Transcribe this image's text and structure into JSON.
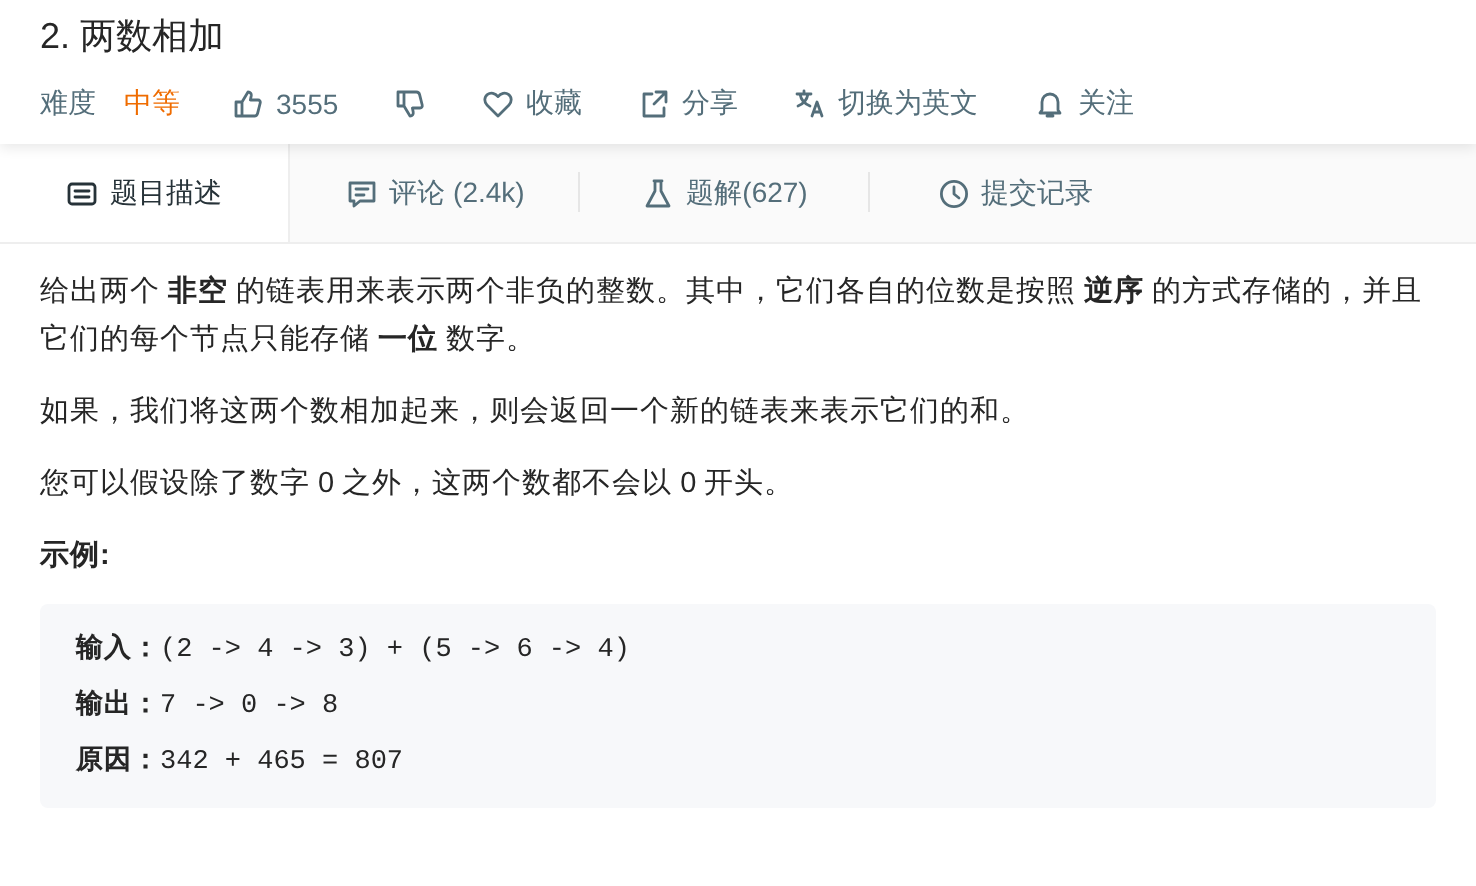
{
  "problem": {
    "title": "2. 两数相加"
  },
  "meta": {
    "difficulty_label": "难度",
    "difficulty": "中等",
    "actions": [
      {
        "kind": "like",
        "label": "3555"
      },
      {
        "kind": "dislike"
      },
      {
        "kind": "favorite",
        "label": "收藏"
      },
      {
        "kind": "share",
        "label": "分享"
      },
      {
        "kind": "translate",
        "label": "切换为英文"
      },
      {
        "kind": "follow",
        "label": "关注"
      }
    ]
  },
  "tabs": [
    {
      "kind": "description",
      "label": "题目描述",
      "selected": true
    },
    {
      "kind": "comments",
      "label": "评论 (2.4k)",
      "selected": false
    },
    {
      "kind": "solutions",
      "label": "题解(627)",
      "selected": false
    },
    {
      "kind": "submissions",
      "label": "提交记录",
      "selected": false
    }
  ],
  "description": {
    "paragraphs": [
      "给出两个 **非空** 的链表用来表示两个非负的整数。其中，它们各自的位数是按照 **逆序** 的方式存储的，并且它们的每个节点只能存储 **一位** 数字。",
      "如果，我们将这两个数相加起来，则会返回一个新的链表来表示它们的和。",
      "您可以假设除了数字 0 之外，这两个数都不会以 0 开头。"
    ],
    "example_heading": "示例:",
    "example_lines": [
      {
        "label": "输入：",
        "value": "(2 -> 4 -> 3) + (5 -> 6 -> 4)"
      },
      {
        "label": "输出：",
        "value": "7 -> 0 -> 8"
      },
      {
        "label": "原因：",
        "value": "342 + 465 = 807"
      }
    ]
  }
}
